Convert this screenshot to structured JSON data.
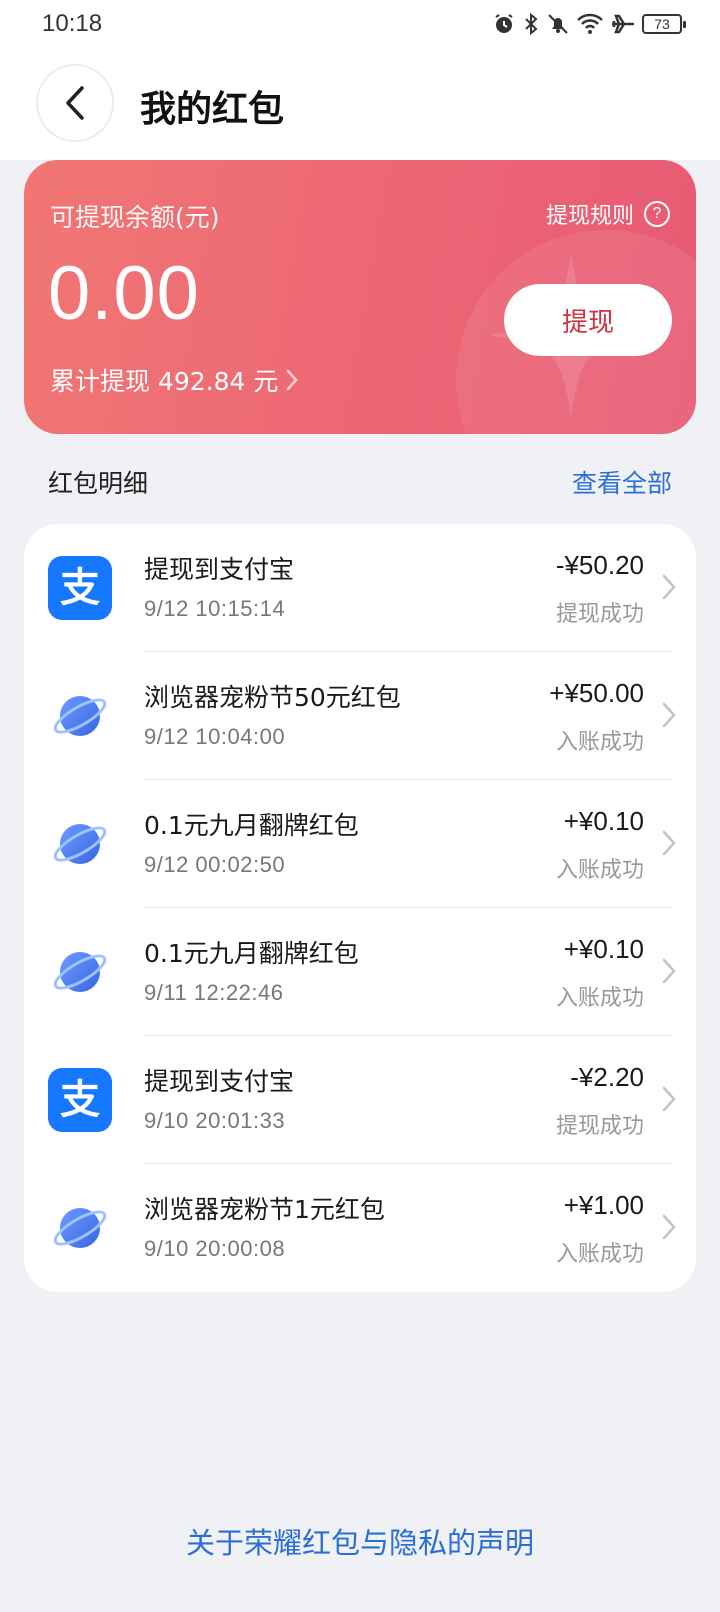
{
  "status_bar": {
    "time": "10:18",
    "battery": "73",
    "icons": [
      "alarm-icon",
      "bluetooth-icon",
      "mute-icon",
      "wifi-icon",
      "airplane-icon",
      "battery-icon"
    ]
  },
  "header": {
    "title": "我的红包"
  },
  "balance_card": {
    "label": "可提现余额(元)",
    "rules_label": "提现规则",
    "balance": "0.00",
    "total_withdraw": "累计提现 492.84 元",
    "withdraw_button": "提现",
    "colors": {
      "gradient_start": "#f17773",
      "gradient_end": "#e85a73",
      "button_text": "#d2303e"
    }
  },
  "details": {
    "title": "红包明细",
    "view_all": "查看全部",
    "items": [
      {
        "icon": "alipay-icon",
        "title": "提现到支付宝",
        "time": "9/12 10:15:14",
        "amount": "-¥50.20",
        "status": "提现成功"
      },
      {
        "icon": "browser-icon",
        "title": "浏览器宠粉节50元红包",
        "time": "9/12 10:04:00",
        "amount": "+¥50.00",
        "status": "入账成功"
      },
      {
        "icon": "browser-icon",
        "title": "0.1元九月翻牌红包",
        "time": "9/12 00:02:50",
        "amount": "+¥0.10",
        "status": "入账成功"
      },
      {
        "icon": "browser-icon",
        "title": "0.1元九月翻牌红包",
        "time": "9/11 12:22:46",
        "amount": "+¥0.10",
        "status": "入账成功"
      },
      {
        "icon": "alipay-icon",
        "title": "提现到支付宝",
        "time": "9/10 20:01:33",
        "amount": "-¥2.20",
        "status": "提现成功"
      },
      {
        "icon": "browser-icon",
        "title": "浏览器宠粉节1元红包",
        "time": "9/10 20:00:08",
        "amount": "+¥1.00",
        "status": "入账成功"
      }
    ]
  },
  "footer": {
    "privacy_link": "关于荣耀红包与隐私的声明"
  },
  "colors": {
    "background": "#f0f1f5",
    "accent_link": "#2a6ed6",
    "alipay": "#1677ff",
    "browser_icon": "#4a7ff0"
  }
}
